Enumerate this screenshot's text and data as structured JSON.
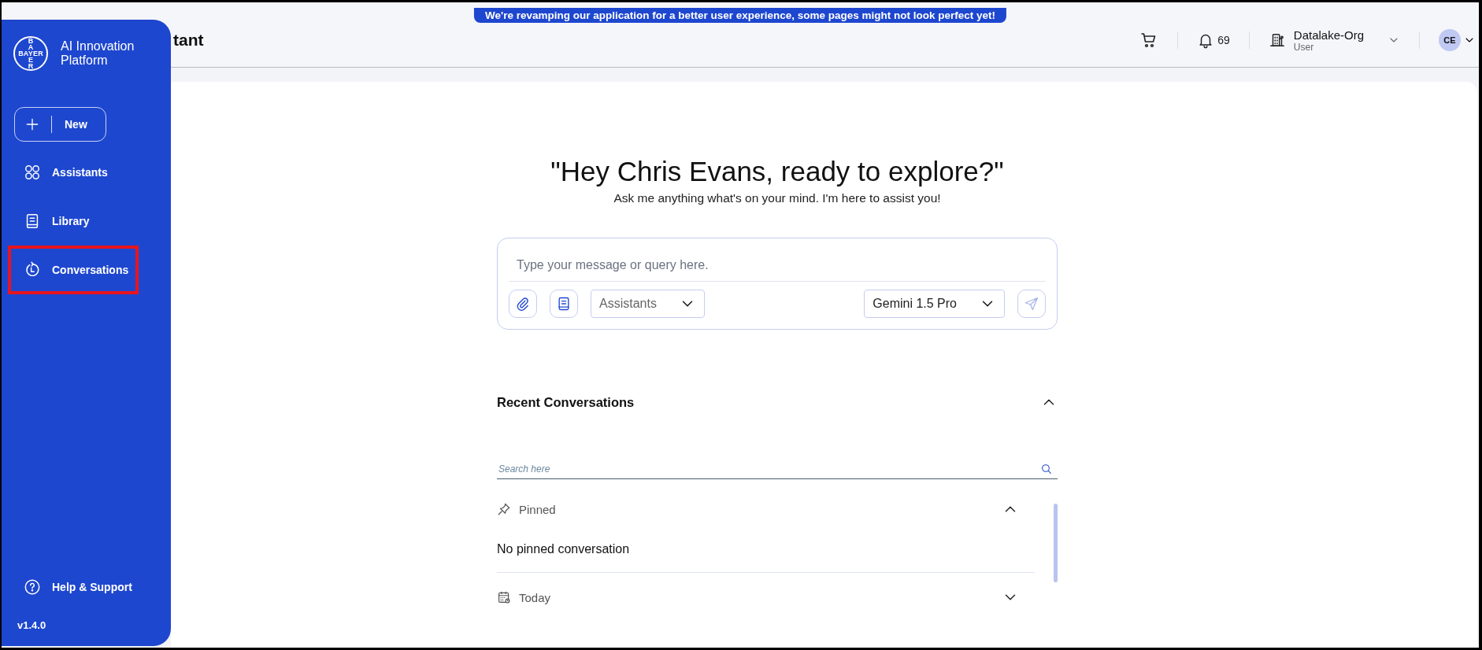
{
  "banner": {
    "text": "We're revamping our application for a better user experience, some pages might not look perfect yet!"
  },
  "header": {
    "title": "tant",
    "notifications": "69",
    "org": {
      "name": "Datalake-Org",
      "role": "User"
    },
    "avatar": "CE"
  },
  "sidebar": {
    "logo": {
      "top": "BA",
      "horizontal": "BAYER",
      "bottom": "ER"
    },
    "title": "AI Innovation Platform",
    "new_button": "New",
    "items": [
      {
        "label": "Assistants",
        "kind": "grid",
        "highlighted": false
      },
      {
        "label": "Library",
        "kind": "book",
        "highlighted": false
      },
      {
        "label": "Conversations",
        "kind": "history",
        "highlighted": true
      }
    ],
    "help": "Help & Support",
    "version": "v1.4.0"
  },
  "main": {
    "greeting": "\"Hey Chris Evans, ready to explore?\"",
    "subtitle": "Ask me anything what's on your mind. I'm here to assist you!",
    "composer": {
      "placeholder": "Type your message or query here.",
      "assistant_select": "Assistants",
      "model_select": "Gemini 1.5 Pro",
      "send_enabled": false
    },
    "recent": {
      "title": "Recent Conversations",
      "expanded": true,
      "search": {
        "placeholder": "Search here"
      },
      "groups": [
        {
          "label": "Pinned",
          "kind": "pin",
          "expanded": true,
          "empty_text": "No pinned conversation"
        },
        {
          "label": "Today",
          "kind": "calendar",
          "expanded": false
        }
      ]
    }
  }
}
